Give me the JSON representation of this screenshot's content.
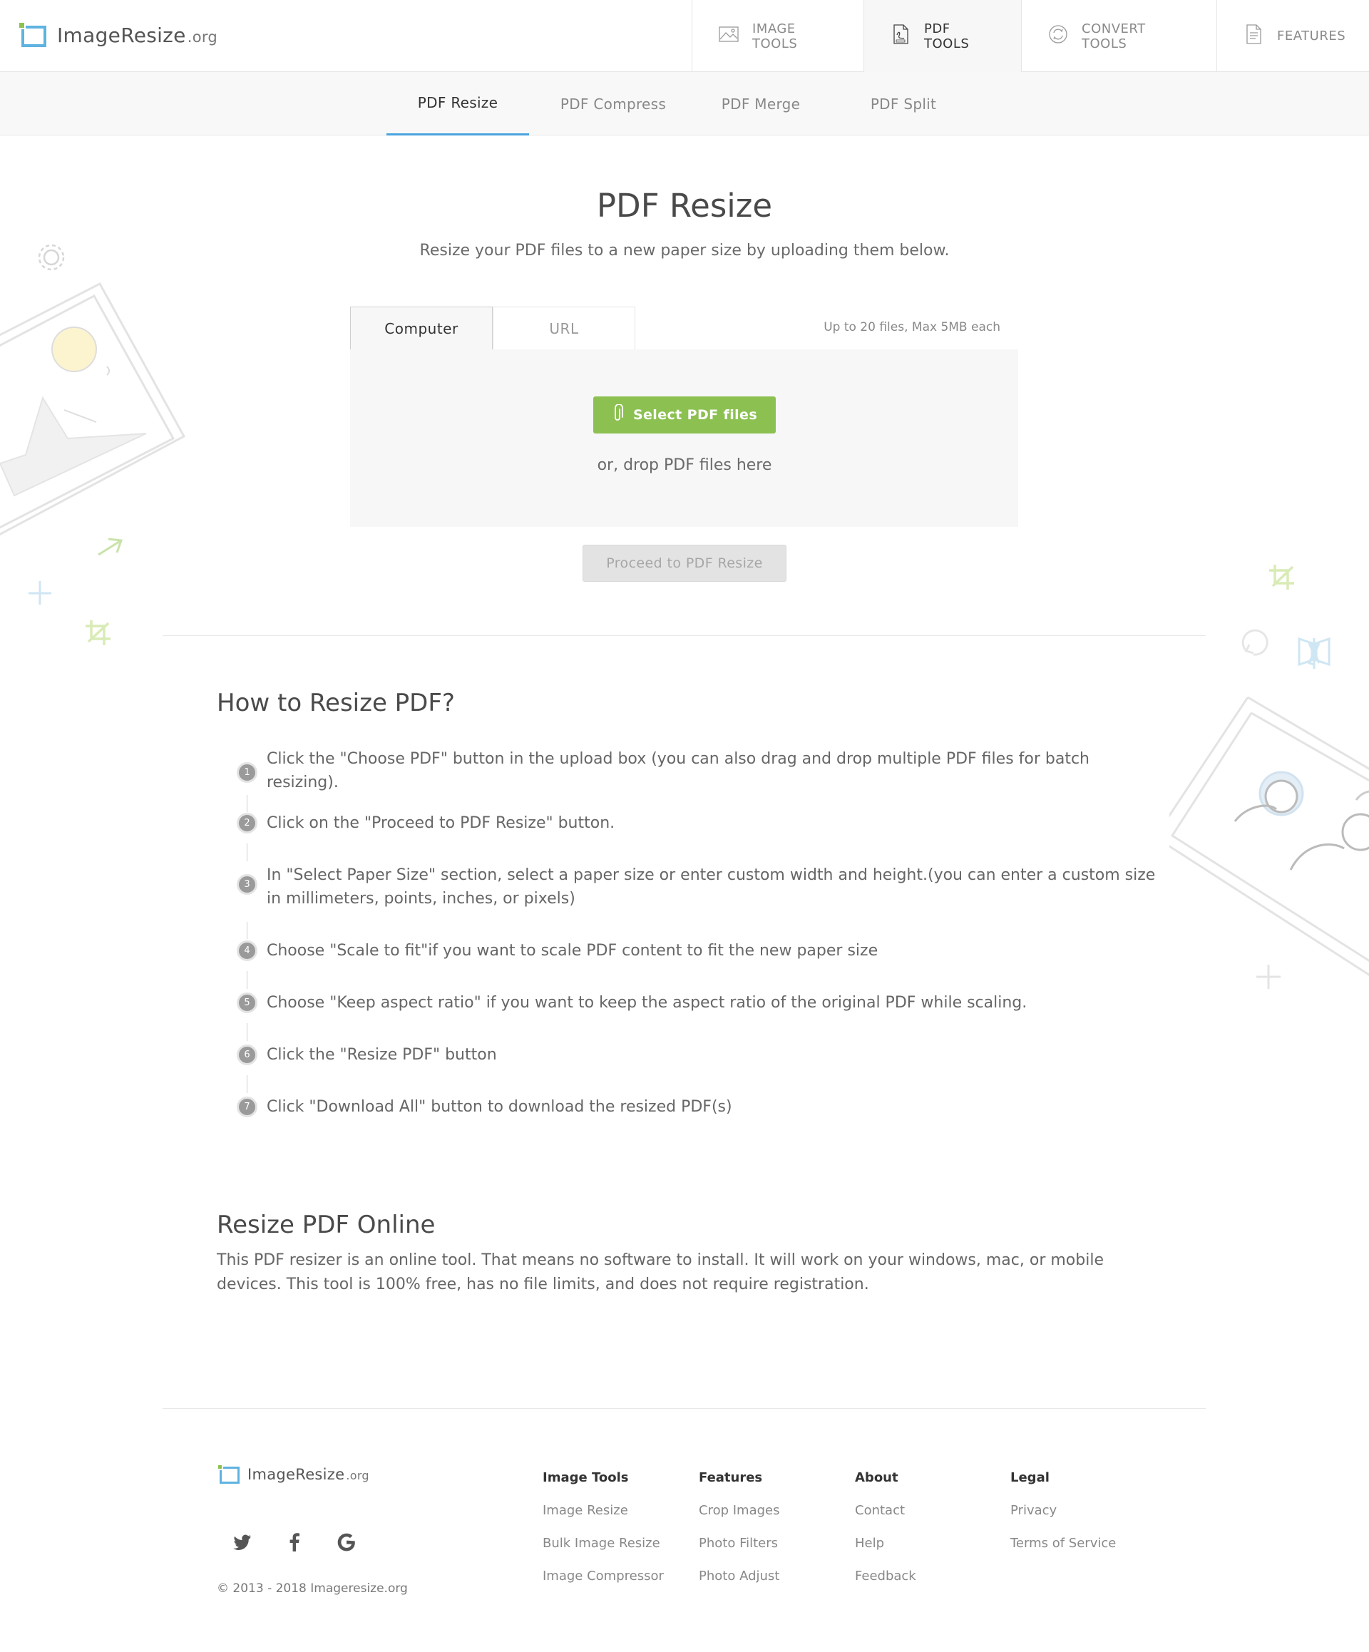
{
  "header": {
    "logo_name": "ImageResize",
    "logo_tld": ".org",
    "nav": [
      {
        "label": "IMAGE TOOLS",
        "icon": "image-icon"
      },
      {
        "label": "PDF TOOLS",
        "icon": "pdf-icon"
      },
      {
        "label": "CONVERT TOOLS",
        "icon": "convert-icon"
      },
      {
        "label": "FEATURES",
        "icon": "document-icon"
      }
    ]
  },
  "subnav": {
    "tabs": [
      "PDF Resize",
      "PDF Compress",
      "PDF Merge",
      "PDF Split"
    ]
  },
  "main": {
    "title": "PDF Resize",
    "subtitle": "Resize your PDF files to a new paper size by uploading them below.",
    "upload_tabs": [
      "Computer",
      "URL"
    ],
    "limit_note": "Up to 20 files, Max 5MB each",
    "select_label": "Select PDF files",
    "drop_hint": "or, drop PDF files here",
    "proceed_label": "Proceed to PDF Resize"
  },
  "howto": {
    "title": "How to Resize PDF?",
    "steps": [
      {
        "num": "1",
        "text": "Click the \"Choose PDF\" button in the upload box (you can also drag and drop multiple PDF files for batch resizing)."
      },
      {
        "num": "2",
        "text": "Click on the \"Proceed to PDF Resize\" button."
      },
      {
        "num": "3",
        "text": "In \"Select Paper Size\" section, select a paper size or enter custom width and height.(you can enter a custom size in millimeters, points, inches, or pixels)"
      },
      {
        "num": "4",
        "text": "Choose \"Scale to fit\"if you want to scale PDF content to fit the new paper size"
      },
      {
        "num": "5",
        "text": "Choose \"Keep aspect ratio\" if you want to keep the aspect ratio of the original PDF while scaling."
      },
      {
        "num": "6",
        "text": "Click the \"Resize PDF\" button"
      },
      {
        "num": "7",
        "text": "Click \"Download All\" button to download the resized PDF(s)"
      }
    ]
  },
  "online": {
    "title": "Resize PDF Online",
    "text": "This PDF resizer is an online tool. That means no software to install. It will work on your windows, mac, or mobile devices. This tool is 100% free, has no file limits, and does not require registration."
  },
  "footer": {
    "logo_name": "ImageResize",
    "logo_tld": ".org",
    "social": [
      "twitter-icon",
      "facebook-icon",
      "google-icon"
    ],
    "copyright": "© 2013 - 2018 Imageresize.org",
    "columns": [
      {
        "heading": "Image Tools",
        "links": [
          "Image Resize",
          "Bulk Image Resize",
          "Image Compressor"
        ]
      },
      {
        "heading": "Features",
        "links": [
          "Crop Images",
          "Photo Filters",
          "Photo Adjust"
        ]
      },
      {
        "heading": "About",
        "links": [
          "Contact",
          "Help",
          "Feedback"
        ]
      },
      {
        "heading": "Legal",
        "links": [
          "Privacy",
          "Terms of Service"
        ]
      }
    ]
  },
  "colors": {
    "accent_green": "#8cc152",
    "accent_blue": "#4aa3df",
    "logo_blue": "#5eb3e0"
  }
}
